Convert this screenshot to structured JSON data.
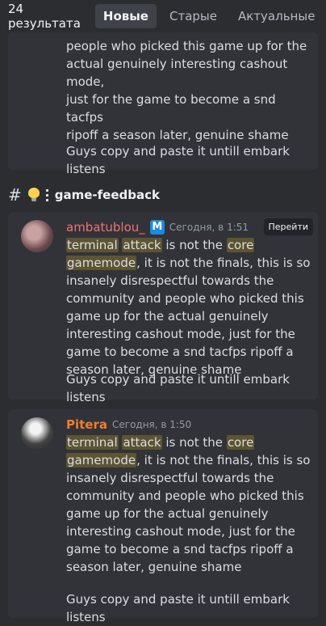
{
  "topbar": {
    "result_count": "24 результата",
    "tabs": [
      {
        "label": "Новые",
        "active": true
      },
      {
        "label": "Старые",
        "active": false
      },
      {
        "label": "Актуальные",
        "active": false
      }
    ]
  },
  "orphan": {
    "lines": [
      "people who picked this game up for the",
      "actual genuinely interesting cashout mode,",
      "just for the game to become a snd tacfps",
      "ripoff a season later, genuine shame"
    ],
    "tail": "Guys copy and paste it untill embark listens"
  },
  "channel": {
    "hash": "#",
    "name": "game-feedback",
    "icons": [
      "lightbulb-icon",
      "dots-icon"
    ]
  },
  "messages": [
    {
      "author": "ambatublou_",
      "badge": "M",
      "time": "Сегодня, в 1:51",
      "jump_label": "Перейти",
      "line1": {
        "hl1": "terminal",
        "hl2": "attack",
        "mid": "is not the",
        "hl3": "core",
        "hl4": "gamemode",
        "end": ","
      },
      "rest": "it is not the finals, this is so insanely disrespectful towards the community and people who picked this game up for the actual genuinely interesting cashout mode, just for the game to become a snd tacfps ripoff a season later, genuine shame",
      "tail": "Guys copy and paste it untill embark listens"
    },
    {
      "author": "Pitera",
      "time": "Сегодня, в 1:50",
      "line1": {
        "hl1": "terminal",
        "hl2": "attack",
        "mid": "is not the",
        "hl3": "core",
        "hl4": "gamemode",
        "end": ","
      },
      "rest": "it is not the finals, this is so insanely disrespectful towards the community and people who picked this game up for the actual genuinely interesting cashout mode, just for the game to become a snd tacfps ripoff a season later, genuine shame",
      "tail": "Guys copy and paste it untill embark listens"
    }
  ],
  "colors": {
    "background": "#2b2d31",
    "card": "#313338",
    "highlight": "#5c5432",
    "author1": "#f27171",
    "author2": "#f27c2a",
    "badge": "#1e88e5"
  }
}
